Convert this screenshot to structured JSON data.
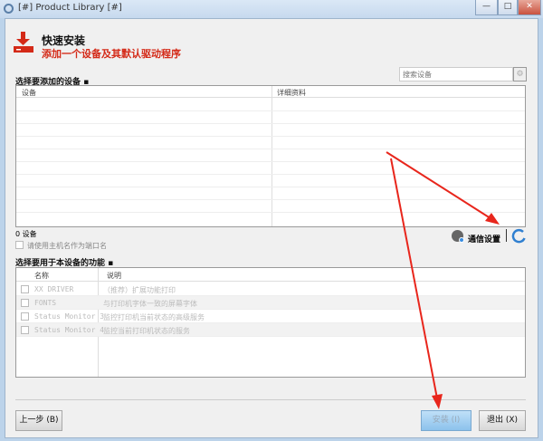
{
  "window": {
    "title": "[#] Product Library [#]",
    "min": "—",
    "max": "□",
    "close": "✕"
  },
  "header": {
    "title": "快速安装",
    "subtitle": "添加一个设备及其默认驱动程序"
  },
  "devices": {
    "label": "选择要添加的设备 ▪",
    "search_placeholder": "搜索设备",
    "columns": [
      "设备",
      "详细资料"
    ],
    "count": "0 设备",
    "hostname_checkbox": "请使用主机名作为端口名",
    "comm_settings": "通信设置"
  },
  "functions": {
    "label": "选择要用于本设备的功能 ▪",
    "columns": [
      "名称",
      "说明"
    ],
    "rows": [
      {
        "name": "XX DRIVER",
        "desc": "（推荐）扩展功能打印"
      },
      {
        "name": "FONTS",
        "desc": "与打印机字体一致的屏幕字体"
      },
      {
        "name": "Status Monitor 3",
        "desc": "监控打印机当前状态的高级服务"
      },
      {
        "name": "Status Monitor 4",
        "desc": "监控当前打印机状态的服务"
      }
    ]
  },
  "buttons": {
    "back": "上一步 (B)",
    "install": "安装 (I)",
    "exit": "退出 (X)"
  },
  "colors": {
    "accent": "#d42a18",
    "arrow": "#e8261c"
  }
}
